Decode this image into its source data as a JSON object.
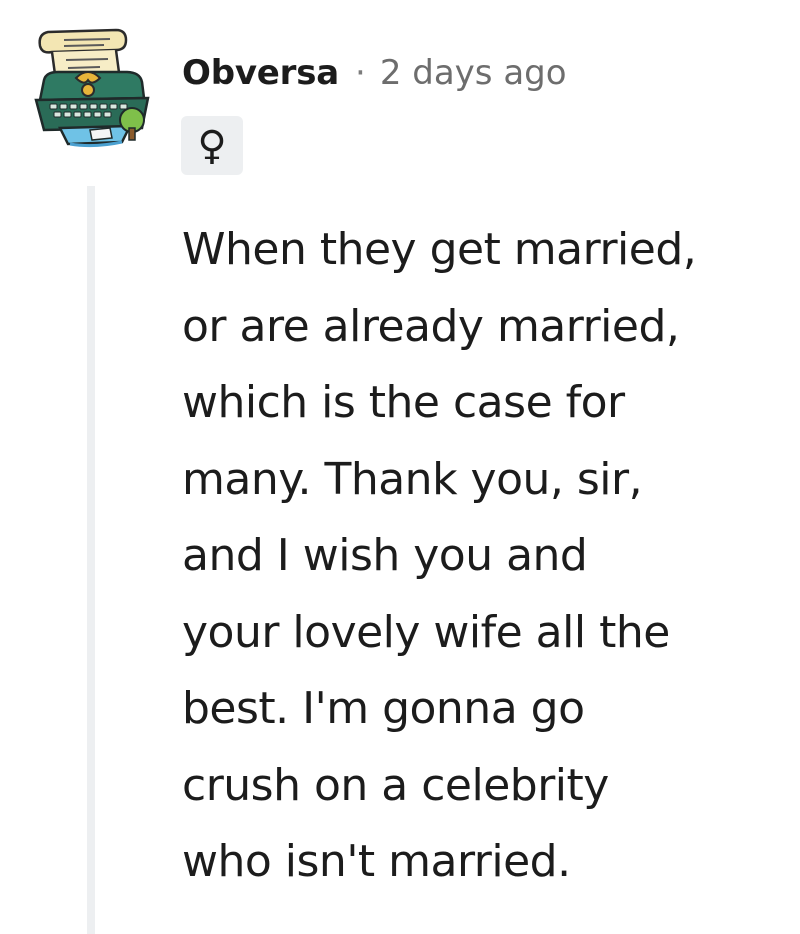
{
  "comment": {
    "author": "Obversa",
    "separator": "·",
    "timestamp": "2 days ago",
    "flair": "♀",
    "avatar_icon": "typewriter-scroll-avatar-icon",
    "body_lines": [
      "When they get married,",
      "or are already married,",
      "which is the case for",
      "many. Thank you, sir,",
      "and I wish you and",
      "your lovely wife all the",
      "best. I'm gonna go",
      "crush on a celebrity",
      "who isn't married."
    ]
  },
  "colors": {
    "text": "#1c1c1c",
    "muted": "#6d6d6d",
    "flair_bg": "#edeff1",
    "thread_line": "#edeff1"
  }
}
